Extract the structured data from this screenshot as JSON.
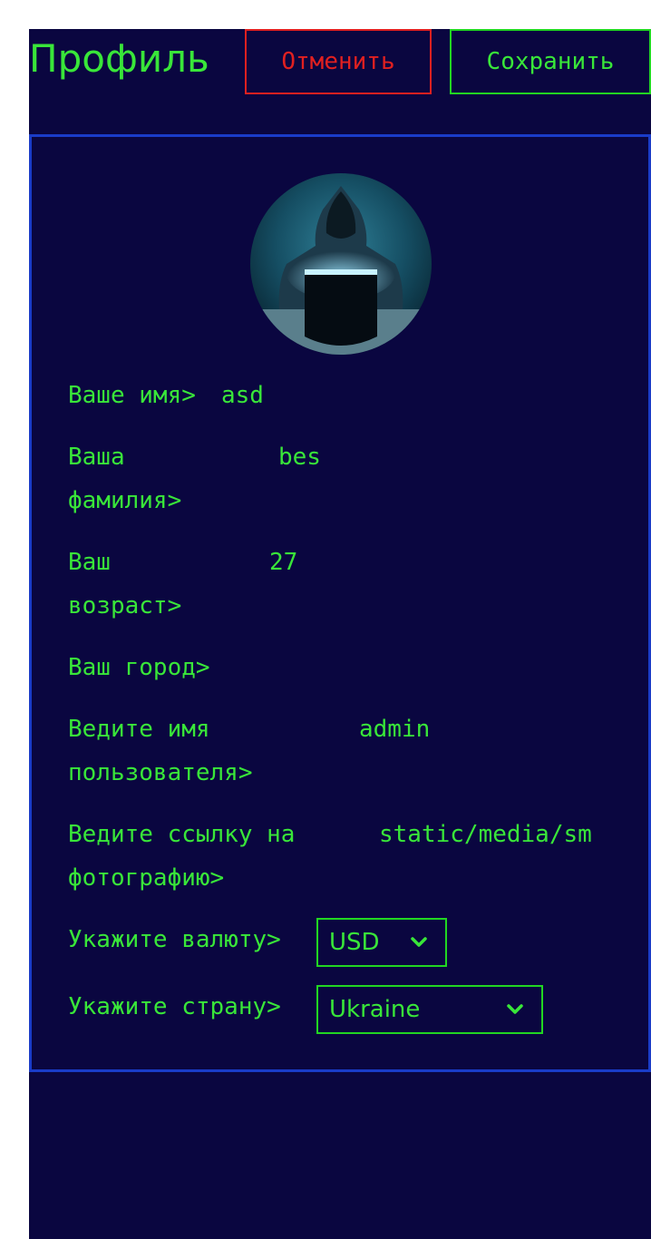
{
  "header": {
    "title": "Профиль",
    "cancel_label": "Отменить",
    "save_label": "Сохранить"
  },
  "form": {
    "first_name": {
      "label": "Ваше имя>",
      "value": "asd"
    },
    "last_name": {
      "label_line1": "Ваша",
      "label_line2": "фамилия>",
      "value": "bes"
    },
    "age": {
      "label_line1": "Ваш",
      "label_line2": "возраст>",
      "value": "27"
    },
    "city": {
      "label": "Ваш город>",
      "value": ""
    },
    "username": {
      "label_line1": "Ведите имя",
      "label_line2": "пользователя>",
      "value": "admin"
    },
    "photo": {
      "label_line1": "Ведите ссылку на",
      "label_line2": "фотографию>",
      "value": "static/media/sm"
    },
    "currency": {
      "label": "Укажите валюту>",
      "selected": "USD"
    },
    "country": {
      "label": "Укажите страну>",
      "selected": "Ukraine"
    }
  },
  "icons": {
    "currency_chevron": "chevron-down-icon",
    "country_chevron": "chevron-down-icon"
  },
  "colors": {
    "background": "#0a0640",
    "accent": "#39e639",
    "danger": "#e02020",
    "card_border": "#1a3cc8"
  }
}
